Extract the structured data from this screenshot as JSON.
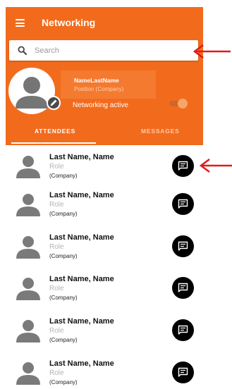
{
  "header": {
    "title": "Networking"
  },
  "search": {
    "placeholder": "Search"
  },
  "profile": {
    "name": "NameLastName",
    "position": "Position (Company)",
    "networking_label": "Networking active",
    "networking_active": true
  },
  "tabs": [
    {
      "label": "ATTENDEES",
      "active": true
    },
    {
      "label": "MESSAGES",
      "active": false
    }
  ],
  "attendees": [
    {
      "name": "Last Name, Name",
      "role": "Role",
      "company": "(Company)"
    },
    {
      "name": "Last Name, Name",
      "role": "Role",
      "company": "(Company)"
    },
    {
      "name": "Last Name, Name",
      "role": "Role",
      "company": "(Company)"
    },
    {
      "name": "Last Name, Name",
      "role": "Role",
      "company": "(Company)"
    },
    {
      "name": "Last Name, Name",
      "role": "Role",
      "company": "(Company)"
    },
    {
      "name": "Last Name, Name",
      "role": "Role",
      "company": "(Company)"
    }
  ],
  "colors": {
    "brand": "#f26b1d",
    "annotation_arrow": "#e01b1b"
  },
  "icons": {
    "menu": "menu-icon",
    "search": "search-icon",
    "edit": "edit-icon",
    "chat": "chat-icon",
    "avatar": "avatar-icon"
  }
}
